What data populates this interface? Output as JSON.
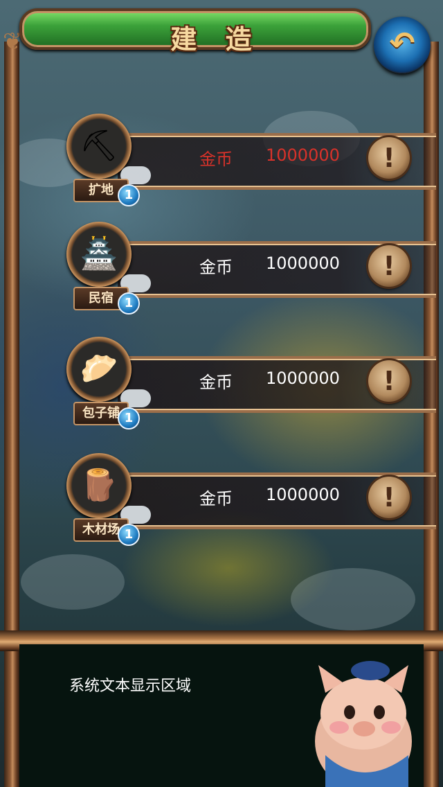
{
  "header": {
    "title": "建 造",
    "back_icon": "back-arrow-icon"
  },
  "buildings": [
    {
      "name": "扩地",
      "level": "1",
      "currency": "金币",
      "cost": "1000000",
      "icon": "shovel-rocks-icon",
      "cost_color": "#d8322a"
    },
    {
      "name": "民宿",
      "level": "1",
      "currency": "金币",
      "cost": "1000000",
      "icon": "inn-icon",
      "cost_color": "#ffffff"
    },
    {
      "name": "包子铺",
      "level": "1",
      "currency": "金币",
      "cost": "1000000",
      "icon": "steamed-buns-icon",
      "cost_color": "#ffffff"
    },
    {
      "name": "木材场",
      "level": "1",
      "currency": "金币",
      "cost": "1000000",
      "icon": "lumber-icon",
      "cost_color": "#ffffff"
    }
  ],
  "dialog": {
    "text": "系统文本显示区域",
    "character": "pig-character"
  },
  "colors": {
    "title_green": "#3ca23a",
    "frame_brown": "#8d5a36",
    "warning_red": "#d8322a"
  }
}
